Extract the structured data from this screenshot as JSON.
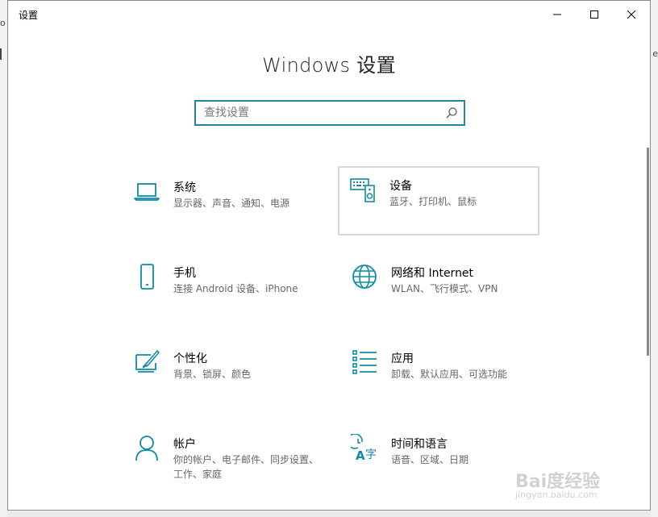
{
  "window": {
    "title": "设置"
  },
  "heading": "Windows 设置",
  "search": {
    "placeholder": "查找设置",
    "value": ""
  },
  "tiles": [
    {
      "name": "系统",
      "desc": "显示器、声音、通知、电源",
      "icon": "laptop-icon"
    },
    {
      "name": "设备",
      "desc": "蓝牙、打印机、鼠标",
      "icon": "keyboard-speaker-icon"
    },
    {
      "name": "手机",
      "desc": "连接 Android 设备、iPhone",
      "icon": "phone-icon"
    },
    {
      "name": "网络和 Internet",
      "desc": "WLAN、飞行模式、VPN",
      "icon": "globe-icon"
    },
    {
      "name": "个性化",
      "desc": "背景、锁屏、颜色",
      "icon": "paintbrush-icon"
    },
    {
      "name": "应用",
      "desc": "卸载、默认应用、可选功能",
      "icon": "apps-list-icon"
    },
    {
      "name": "帐户",
      "desc": "你的帐户、电子邮件、同步设置、工作、家庭",
      "icon": "person-icon"
    },
    {
      "name": "时间和语言",
      "desc": "语音、区域、日期",
      "icon": "time-language-icon"
    }
  ],
  "watermark": {
    "text": "Bai度经验",
    "url": "jingyan.baidu.com"
  },
  "colors": {
    "accent": "#1b8a9e",
    "icon": "#0f8ba8"
  }
}
